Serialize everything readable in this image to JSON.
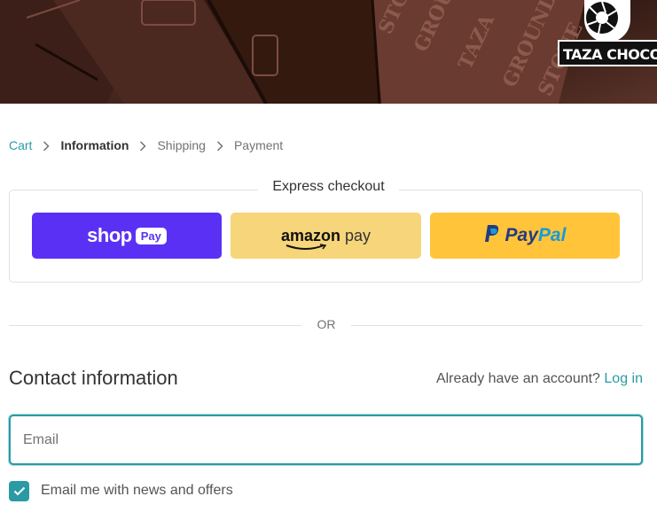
{
  "banner": {
    "logo_text": "TAZA CHOCOLA"
  },
  "breadcrumb": {
    "items": [
      {
        "label": "Cart",
        "state": "link"
      },
      {
        "label": "Information",
        "state": "current"
      },
      {
        "label": "Shipping",
        "state": "upcoming"
      },
      {
        "label": "Payment",
        "state": "upcoming"
      }
    ]
  },
  "express_checkout": {
    "title": "Express checkout",
    "shop_pay": {
      "word": "shop",
      "pill": "Pay"
    },
    "amazon_pay": {
      "word": "amazon",
      "suffix": "pay"
    },
    "paypal": {
      "word_dark": "Pay",
      "word_light": "Pal"
    }
  },
  "divider": {
    "label": "OR"
  },
  "contact": {
    "title": "Contact information",
    "account_prompt": "Already have an account?",
    "login_label": "Log in",
    "email_placeholder": "Email",
    "email_value": "",
    "newsletter_label": "Email me with news and offers",
    "newsletter_checked": true
  },
  "colors": {
    "accent": "#2a9aa5",
    "shop_pay": "#5a31f4",
    "amazon_pay": "#f7d57a",
    "paypal": "#ffc439"
  }
}
